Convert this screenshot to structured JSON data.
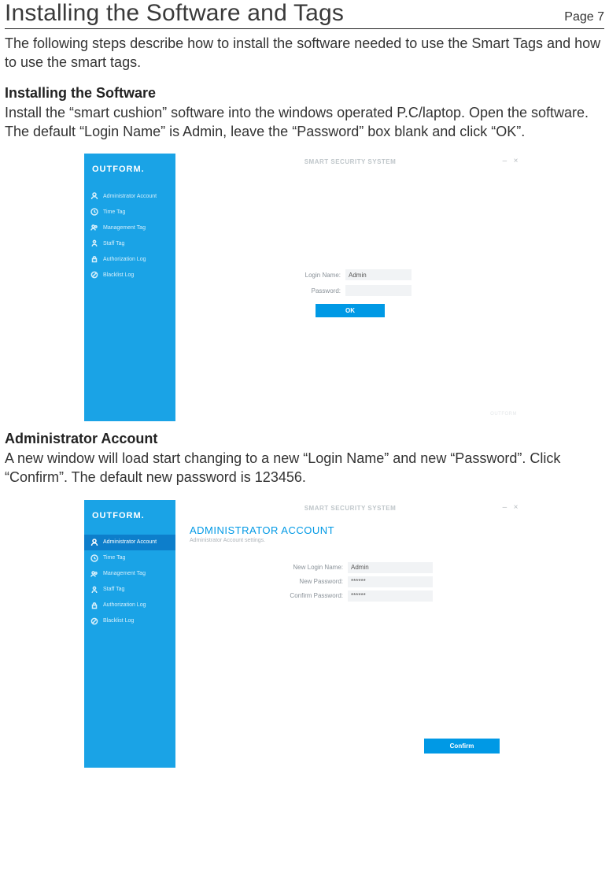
{
  "page": {
    "title": "Installing the Software and Tags",
    "page_label": "Page 7",
    "intro": "The following steps describe how to install the software needed to use the Smart Tags and how to use the smart tags."
  },
  "sections": {
    "install": {
      "heading": "Installing the Software",
      "body": "Install the “smart cushion” software into the windows operated P.C/laptop. Open the software. The default “Login Name” is Admin, leave the “Password” box blank and click “OK”."
    },
    "admin": {
      "heading": "Administrator Account",
      "body": "A new window will load start changing to a new “Login Name” and new “Password”. Click “Confirm”. The default new password is 123456."
    }
  },
  "app": {
    "brand": "OUTFORM.",
    "window_title": "SMART SECURITY SYSTEM",
    "window_minimize": "–",
    "window_close": "×",
    "footer_mark": "OUTFORM"
  },
  "sidebar": {
    "items": [
      {
        "label": "Administrator Account"
      },
      {
        "label": "Time Tag"
      },
      {
        "label": "Management Tag"
      },
      {
        "label": "Staff Tag"
      },
      {
        "label": "Authorization Log"
      },
      {
        "label": "Blacklist Log"
      }
    ]
  },
  "login": {
    "login_label": "Login Name:",
    "login_value": "Admin",
    "password_label": "Password:",
    "password_value": "",
    "ok_label": "OK"
  },
  "admin_screen": {
    "title": "ADMINISTRATOR ACCOUNT",
    "subtitle": "Administrator Account settings.",
    "new_login_label": "New Login Name:",
    "new_login_value": "Admin",
    "new_password_label": "New Password:",
    "new_password_value": "******",
    "confirm_password_label": "Confirm Password:",
    "confirm_password_value": "******",
    "confirm_label": "Confirm"
  }
}
